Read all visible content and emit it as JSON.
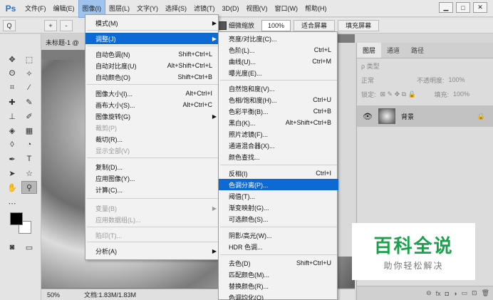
{
  "menubar": {
    "logo": "Ps",
    "items": [
      "文件(F)",
      "编辑(E)",
      "图像(I)",
      "图层(L)",
      "文字(Y)",
      "选择(S)",
      "滤镜(T)",
      "3D(D)",
      "视图(V)",
      "窗口(W)",
      "帮助(H)"
    ],
    "active_index": 2,
    "window_controls": [
      "▁",
      "□",
      "✕"
    ]
  },
  "options_bar": {
    "search_label": "Q",
    "zoom_in_label": "+",
    "zoom_out_label": "-",
    "scrubby_zoom": "细微缩放",
    "zoom_value": "100%",
    "fit_screen": "适合屏幕",
    "fill_screen": "填充屏幕"
  },
  "document": {
    "tab": "未标题-1 @",
    "zoom": "50%",
    "doc_info": "文档:1.83M/1.83M"
  },
  "image_menu": {
    "items": [
      {
        "label": "模式(M)",
        "shortcut": "",
        "arrow": true,
        "disabled": false
      },
      {
        "label": "调整(J)",
        "shortcut": "",
        "arrow": true,
        "disabled": false,
        "highlighted": true
      },
      {
        "label": "自动色调(N)",
        "shortcut": "Shift+Ctrl+L",
        "disabled": false
      },
      {
        "label": "自动对比度(U)",
        "shortcut": "Alt+Shift+Ctrl+L",
        "disabled": false
      },
      {
        "label": "自动颜色(O)",
        "shortcut": "Shift+Ctrl+B",
        "disabled": false
      },
      {
        "label": "图像大小(I)...",
        "shortcut": "Alt+Ctrl+I",
        "disabled": false
      },
      {
        "label": "画布大小(S)...",
        "shortcut": "Alt+Ctrl+C",
        "disabled": false
      },
      {
        "label": "图像旋转(G)",
        "shortcut": "",
        "arrow": true,
        "disabled": false
      },
      {
        "label": "裁剪(P)",
        "shortcut": "",
        "disabled": true
      },
      {
        "label": "裁切(R)...",
        "shortcut": "",
        "disabled": false
      },
      {
        "label": "显示全部(V)",
        "shortcut": "",
        "disabled": true
      },
      {
        "label": "复制(D)...",
        "shortcut": "",
        "disabled": false
      },
      {
        "label": "应用图像(Y)...",
        "shortcut": "",
        "disabled": false
      },
      {
        "label": "计算(C)...",
        "shortcut": "",
        "disabled": false
      },
      {
        "label": "变量(B)",
        "shortcut": "",
        "arrow": true,
        "disabled": true
      },
      {
        "label": "应用数据组(L)...",
        "shortcut": "",
        "disabled": true
      },
      {
        "label": "陷印(T)...",
        "shortcut": "",
        "disabled": true
      },
      {
        "label": "分析(A)",
        "shortcut": "",
        "arrow": true,
        "disabled": false
      }
    ]
  },
  "adjust_menu": {
    "items": [
      {
        "label": "亮度/对比度(C)...",
        "shortcut": ""
      },
      {
        "label": "色阶(L)...",
        "shortcut": "Ctrl+L"
      },
      {
        "label": "曲线(U)...",
        "shortcut": "Ctrl+M"
      },
      {
        "label": "曝光度(E)...",
        "shortcut": ""
      },
      {
        "label": "自然饱和度(V)...",
        "shortcut": ""
      },
      {
        "label": "色相/饱和度(H)...",
        "shortcut": "Ctrl+U"
      },
      {
        "label": "色彩平衡(B)...",
        "shortcut": "Ctrl+B"
      },
      {
        "label": "黑白(K)...",
        "shortcut": "Alt+Shift+Ctrl+B"
      },
      {
        "label": "照片滤镜(F)...",
        "shortcut": ""
      },
      {
        "label": "通道混合器(X)...",
        "shortcut": ""
      },
      {
        "label": "颜色查找...",
        "shortcut": ""
      },
      {
        "label": "反相(I)",
        "shortcut": "Ctrl+I"
      },
      {
        "label": "色调分离(P)...",
        "shortcut": "",
        "highlighted": true
      },
      {
        "label": "阈值(T)...",
        "shortcut": ""
      },
      {
        "label": "渐变映射(G)...",
        "shortcut": ""
      },
      {
        "label": "可选颜色(S)...",
        "shortcut": ""
      },
      {
        "label": "阴影/高光(W)...",
        "shortcut": ""
      },
      {
        "label": "HDR 色调...",
        "shortcut": ""
      },
      {
        "label": "去色(D)",
        "shortcut": "Shift+Ctrl+U"
      },
      {
        "label": "匹配颜色(M)...",
        "shortcut": ""
      },
      {
        "label": "替换颜色(R)...",
        "shortcut": ""
      },
      {
        "label": "色调均化(Q)",
        "shortcut": ""
      }
    ]
  },
  "layers_panel": {
    "tabs": [
      "图层",
      "通道",
      "路径"
    ],
    "filter_label": "ρ 类型",
    "blend_mode": "正常",
    "opacity_label": "不透明度:",
    "opacity_value": "100%",
    "lock_label": "锁定:",
    "fill_label": "填充:",
    "fill_value": "100%",
    "layer_name": "背景"
  },
  "watermark": {
    "title": "百科全说",
    "subtitle": "助你轻松解决"
  },
  "colors": {
    "highlight": "#0d6ad4",
    "watermark_green": "#1aa24a"
  }
}
